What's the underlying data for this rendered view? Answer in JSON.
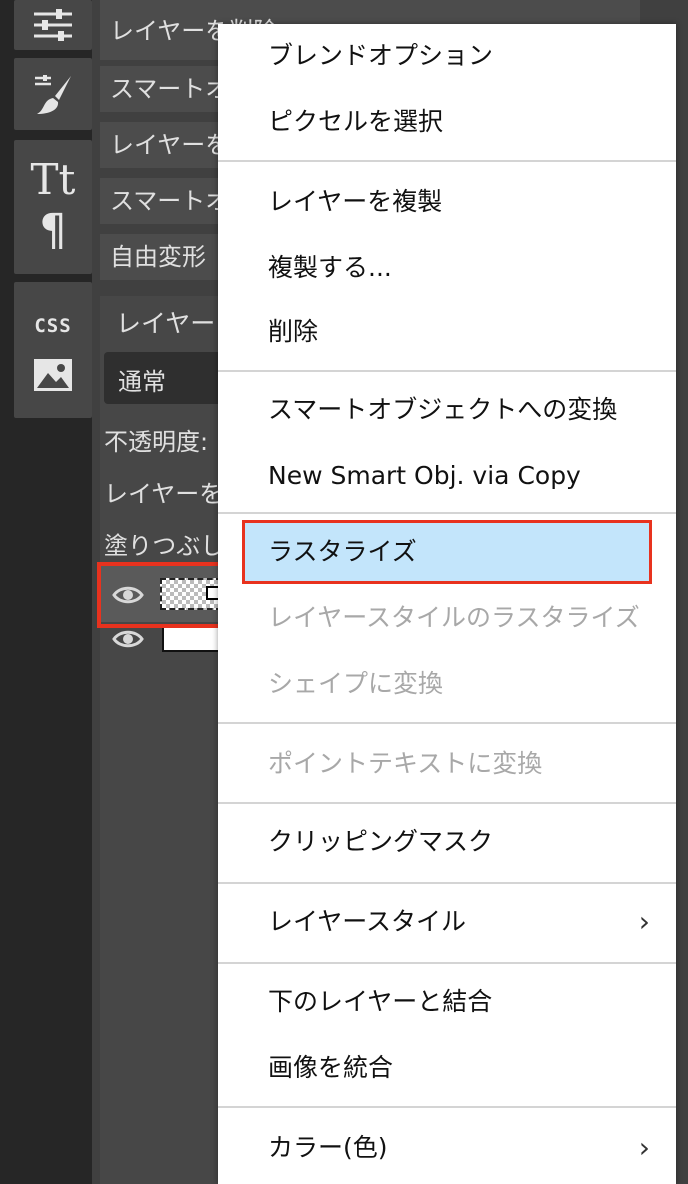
{
  "panel": {
    "rows": [
      "レイヤーを削除",
      "スマートオブジェクト",
      "レイヤーを",
      "スマートオブ",
      "自由変形"
    ],
    "layer_header": "レイヤー",
    "blend_mode": "通常",
    "opacity_label": "不透明度:",
    "lock_label": "レイヤーを",
    "fill_label": "塗りつぶし"
  },
  "menu": {
    "groups": [
      [
        "ブレンドオプション",
        "ピクセルを選択"
      ],
      [
        "レイヤーを複製",
        "複製する...",
        "削除"
      ],
      [
        "スマートオブジェクトへの変換",
        "New Smart Obj. via Copy"
      ],
      [
        "ラスタライズ",
        "レイヤースタイルのラスタライズ",
        "シェイプに変換"
      ],
      [
        "ポイントテキストに変換"
      ],
      [
        "クリッピングマスク"
      ],
      [
        "レイヤースタイル"
      ],
      [
        "下のレイヤーと結合",
        "画像を統合"
      ],
      [
        "カラー(色)"
      ]
    ],
    "disabled": [
      "レイヤースタイルのラスタライズ",
      "シェイプに変換",
      "ポイントテキストに変換"
    ],
    "highlighted": "ラスタライズ",
    "has_submenu": [
      "レイヤースタイル",
      "カラー(色)"
    ]
  },
  "icons": {
    "tools": [
      "sliders-icon",
      "brush-icon",
      "text-icon",
      "paragraph-icon",
      "css-icon",
      "image-icon"
    ],
    "layers": [
      "eye-icon"
    ]
  },
  "colors": {
    "highlight_bg": "#c3e5fb",
    "annotation_red": "#e8321e"
  }
}
